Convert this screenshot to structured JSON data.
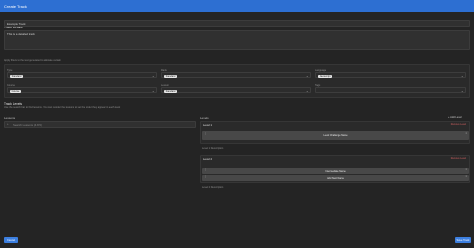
{
  "window": {
    "title": "Create Track"
  },
  "track_details": {
    "heading": "Track Details",
    "name_value": "Example Track",
    "description_value": "This is a detailed track"
  },
  "filters": {
    "heading": "Filters (optional)",
    "subtext": "Apply filters to the test generated to allocate certain",
    "type_label": "Type",
    "type_value": "Standard",
    "rank_label": "Rank",
    "rank_value": "Standard",
    "language_label": "Language",
    "language_value": "Javascript",
    "course_label": "Course",
    "course_value": "Course",
    "ltype_label": "Lesson",
    "ltype_value": "Standard",
    "tags_label": "Tags"
  },
  "track_levels": {
    "heading": "Track Levels",
    "subtext": "Use the search bar to find lessons. You can reorder the lessons to set the order they appear in each level",
    "lessons_label": "Lessons",
    "search_placeholder": "Search Lessons (4.8.5)",
    "levels_label": "Levels",
    "add_level": "Add Level",
    "level1_title": "Level 1",
    "level1_remove": "Remove Level",
    "level1_items": [
      "Level Challenge Name"
    ],
    "level1_description": "Level 1 Description",
    "level2_title": "Level 2",
    "level2_remove": "Remove Level",
    "level2_items": [
      "Intermediate Name",
      "Add Next Name"
    ],
    "level2_description": "Level 2 Description"
  },
  "footer": {
    "cancel": "Cancel",
    "save": "Save Track"
  }
}
